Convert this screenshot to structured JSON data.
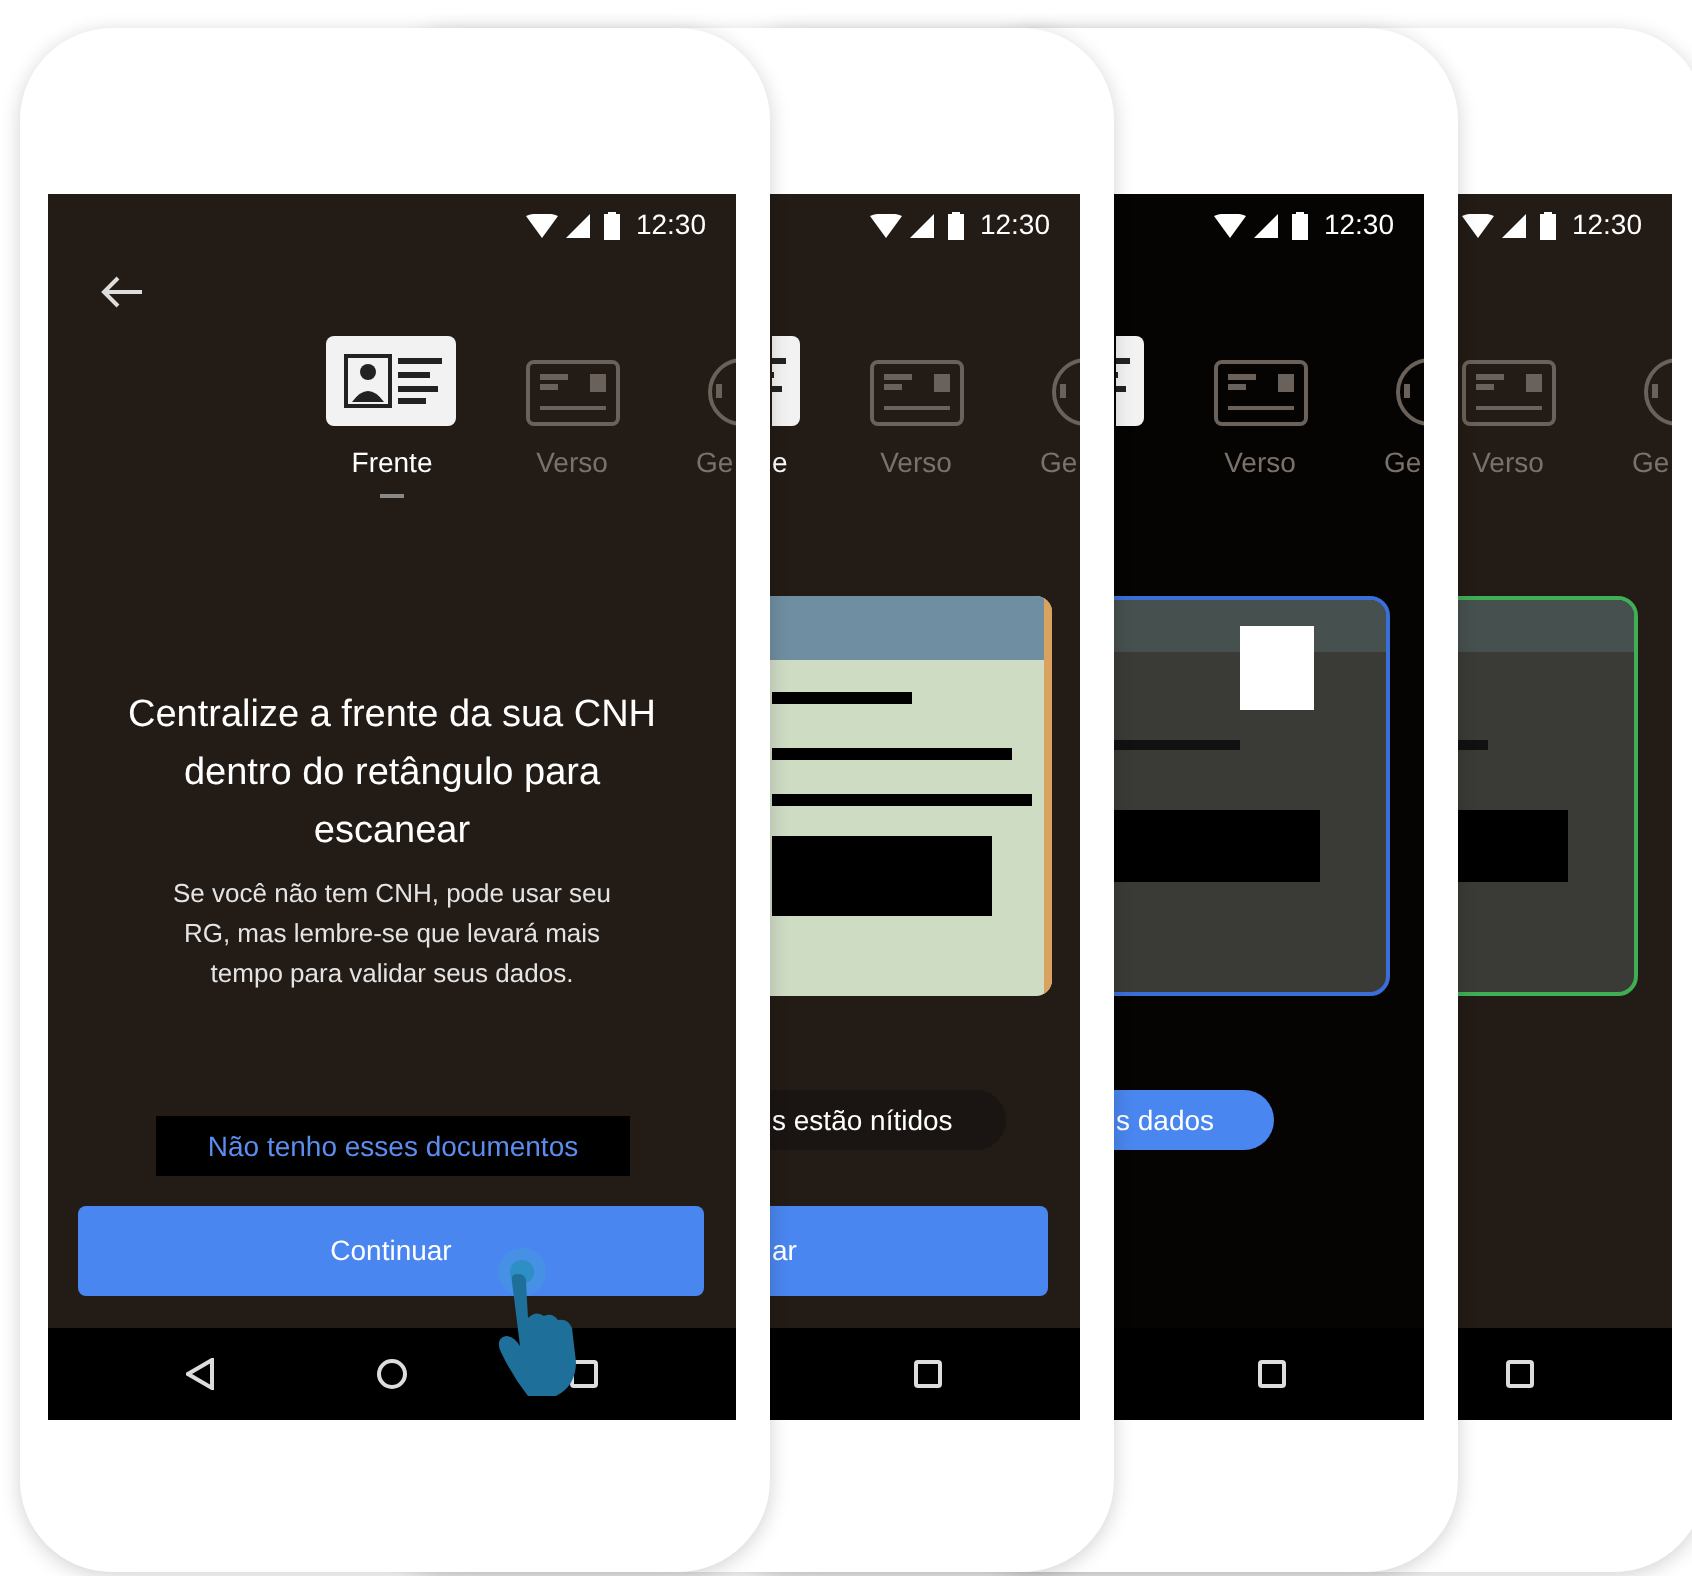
{
  "phones": [
    {
      "kind": "intro",
      "dimmed": false,
      "status_time": "12:30",
      "touch_indicator": true,
      "tabs": [
        {
          "label": "Frente",
          "selected": true
        },
        {
          "label": "Verso",
          "selected": false
        },
        {
          "label": "Ge",
          "selected": false
        }
      ],
      "heading": "Centralize a frente da sua CNH dentro do retângulo para escanear",
      "body": "Se você não tem CNH, pode usar seu RG, mas lembre-se que levará mais tempo para validar seus dados.",
      "link": "Não tenho esses documentos",
      "button": "Continuar"
    },
    {
      "kind": "scan",
      "dimmed": false,
      "status_time": "12:30",
      "tabs": [
        {
          "label": "e",
          "selected": true
        },
        {
          "label": "Verso",
          "selected": false
        },
        {
          "label": "Ge",
          "selected": false
        }
      ],
      "card": {
        "kind": "sharp"
      },
      "pill": {
        "text": "s estão nítidos",
        "kind": "dark"
      },
      "button": "ar"
    },
    {
      "kind": "scan",
      "dimmed": true,
      "status_time": "12:30",
      "tabs": [
        {
          "selected": true
        },
        {
          "label": "Verso",
          "selected": false
        },
        {
          "label": "Ge",
          "selected": false
        }
      ],
      "card": {
        "kind": "blurred",
        "color": "#3b6fd8",
        "redacted": true
      },
      "pill": {
        "text": "s dados",
        "kind": "blue"
      }
    },
    {
      "kind": "scan",
      "dimmed": false,
      "status_time": "12:30",
      "tabs": [
        {
          "label": "Verso",
          "selected": false
        },
        {
          "label": "Ge",
          "selected": false
        }
      ],
      "card": {
        "kind": "blurred",
        "color": "#3fae55"
      }
    }
  ]
}
